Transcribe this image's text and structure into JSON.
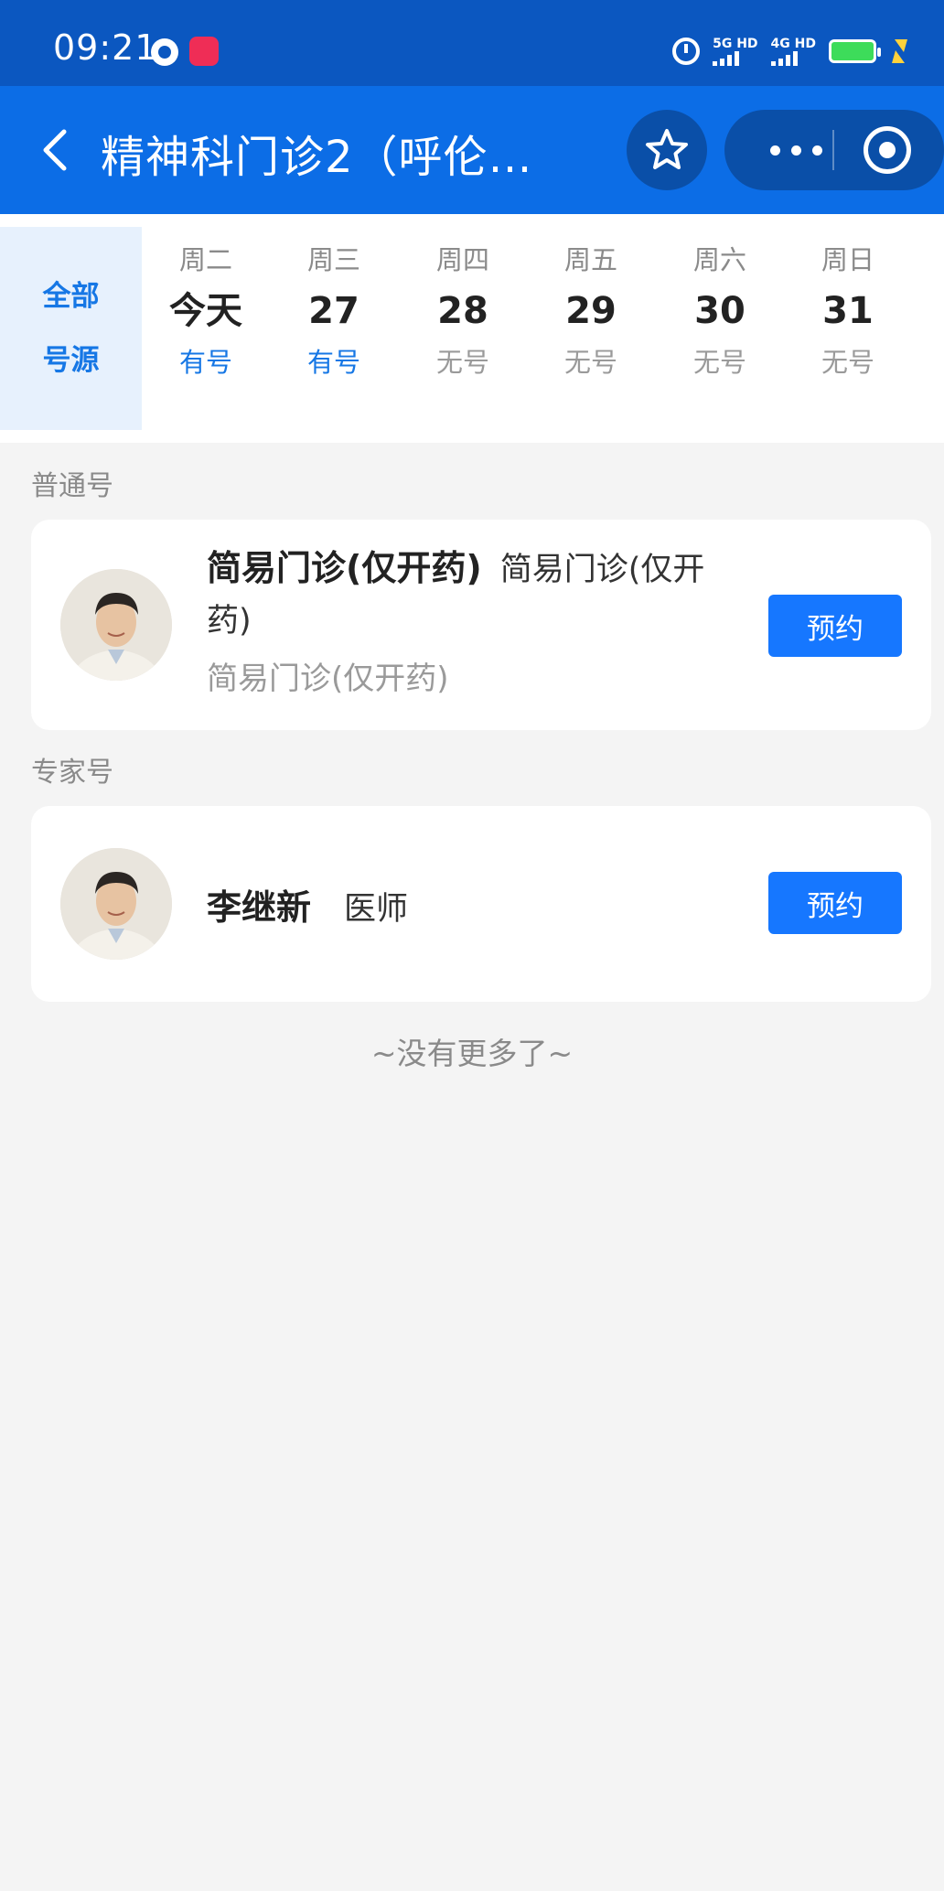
{
  "status_bar": {
    "time": "09:21",
    "net1": "5G HD",
    "net2": "4G HD",
    "battery_color": "#3ddc5a"
  },
  "navbar": {
    "title": "精神科门诊2（呼伦…",
    "back_icon": "chevron-left-icon",
    "star_icon": "star-icon",
    "more_icon": "more-dots-icon",
    "close_icon": "target-circle-icon"
  },
  "date_bar": {
    "all_label_line1": "全部",
    "all_label_line2": "号源",
    "days": [
      {
        "weekday": "周二",
        "date": "今天",
        "status": "有号",
        "available": true
      },
      {
        "weekday": "周三",
        "date": "27",
        "status": "有号",
        "available": true
      },
      {
        "weekday": "周四",
        "date": "28",
        "status": "无号",
        "available": false
      },
      {
        "weekday": "周五",
        "date": "29",
        "status": "无号",
        "available": false
      },
      {
        "weekday": "周六",
        "date": "30",
        "status": "无号",
        "available": false
      },
      {
        "weekday": "周日",
        "date": "31",
        "status": "无号",
        "available": false
      }
    ]
  },
  "sections": {
    "regular": {
      "label": "普通号",
      "card": {
        "name": "简易门诊(仅开药)",
        "title": "简易门诊(仅开药)",
        "subtitle": "简易门诊(仅开药)",
        "button": "预约"
      }
    },
    "expert": {
      "label": "专家号",
      "card": {
        "name": "李继新",
        "title": "医师",
        "button": "预约"
      }
    }
  },
  "footer": {
    "no_more": "~没有更多了~"
  },
  "colors": {
    "primary": "#1677ff",
    "navbar": "#0c6de6",
    "status_bar": "#0b57c0",
    "available": "#1677e5"
  }
}
